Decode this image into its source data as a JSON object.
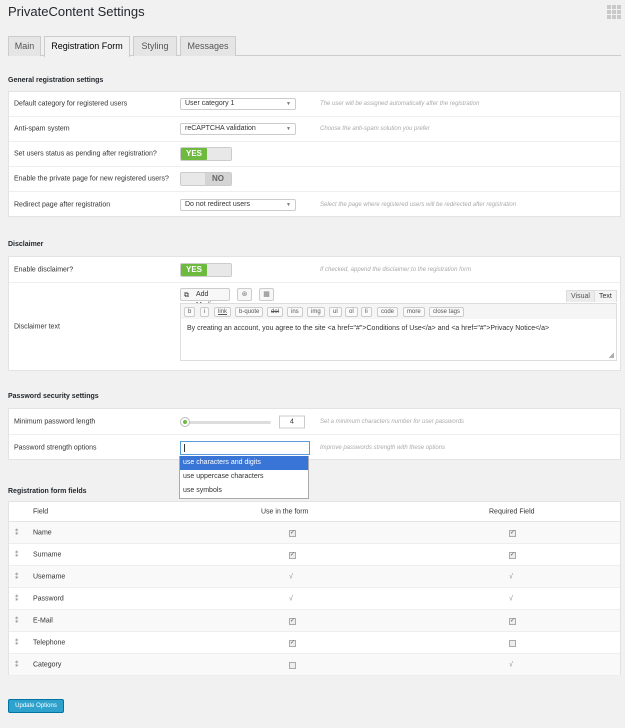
{
  "page_title": "PrivateContent Settings",
  "tabs": [
    {
      "label": "Main"
    },
    {
      "label": "Registration Form"
    },
    {
      "label": "Styling"
    },
    {
      "label": "Messages"
    }
  ],
  "general": {
    "title": "General registration settings",
    "default_category": {
      "label": "Default category for registered users",
      "value": "User category 1",
      "desc": "The user will be assigned automatically after the registration"
    },
    "antispam": {
      "label": "Anti-spam system",
      "value": "reCAPTCHA validation",
      "desc": "Choose the anti-spam solution you prefer"
    },
    "pending": {
      "label": "Set users status as pending after registration?",
      "state": "YES"
    },
    "private_page": {
      "label": "Enable the private page for new registered users?",
      "state": "NO"
    },
    "redirect": {
      "label": "Redirect page after registration",
      "value": "Do not redirect users",
      "desc": "Select the page where registered users will be redirected after registration"
    }
  },
  "disclaimer": {
    "title": "Disclaimer",
    "enable": {
      "label": "Enable disclaimer?",
      "state": "YES",
      "desc": "If checked, append the disclaimer to the registration form"
    },
    "text_label": "Disclaimer text",
    "add_media": "Add Media",
    "visual_tab": "Visual",
    "text_tab": "Text",
    "quicktags": [
      "b",
      "i",
      "link",
      "b-quote",
      "del",
      "ins",
      "img",
      "ul",
      "ol",
      "li",
      "code",
      "more",
      "close tags"
    ],
    "content": "By creating an account, you agree to the site <a href=\"#\">Conditions of Use</a> and <a href=\"#\">Privacy Notice</a>"
  },
  "password": {
    "title": "Password security settings",
    "min_length": {
      "label": "Minimum password length",
      "value": "4",
      "desc": "Set a minimum characters number for user passwords"
    },
    "strength": {
      "label": "Password strength options",
      "desc": "Improve passwords strength with these options"
    },
    "options": [
      "use characters and digits",
      "use uppercase characters",
      "use symbols"
    ]
  },
  "fields": {
    "title": "Registration form fields",
    "headers": {
      "field": "Field",
      "use": "Use in the form",
      "required": "Required Field"
    },
    "rows": [
      {
        "name": "Name",
        "use": "checkbox-on",
        "required": "checkbox-on"
      },
      {
        "name": "Surname",
        "use": "checkbox-on",
        "required": "checkbox-on"
      },
      {
        "name": "Username",
        "use": "tick",
        "required": "tick"
      },
      {
        "name": "Password",
        "use": "tick",
        "required": "tick"
      },
      {
        "name": "E-Mail",
        "use": "checkbox-on",
        "required": "checkbox-on"
      },
      {
        "name": "Telephone",
        "use": "checkbox-on",
        "required": "checkbox-off"
      },
      {
        "name": "Category",
        "use": "checkbox-off",
        "required": "tick"
      }
    ],
    "tick_glyph": "√",
    "drag_glyph": "⁑"
  },
  "submit_label": "Update Options",
  "colors": {
    "accent": "#2ea2cc",
    "toggle_on": "#6dba3e",
    "highlight": "#3875d7"
  }
}
